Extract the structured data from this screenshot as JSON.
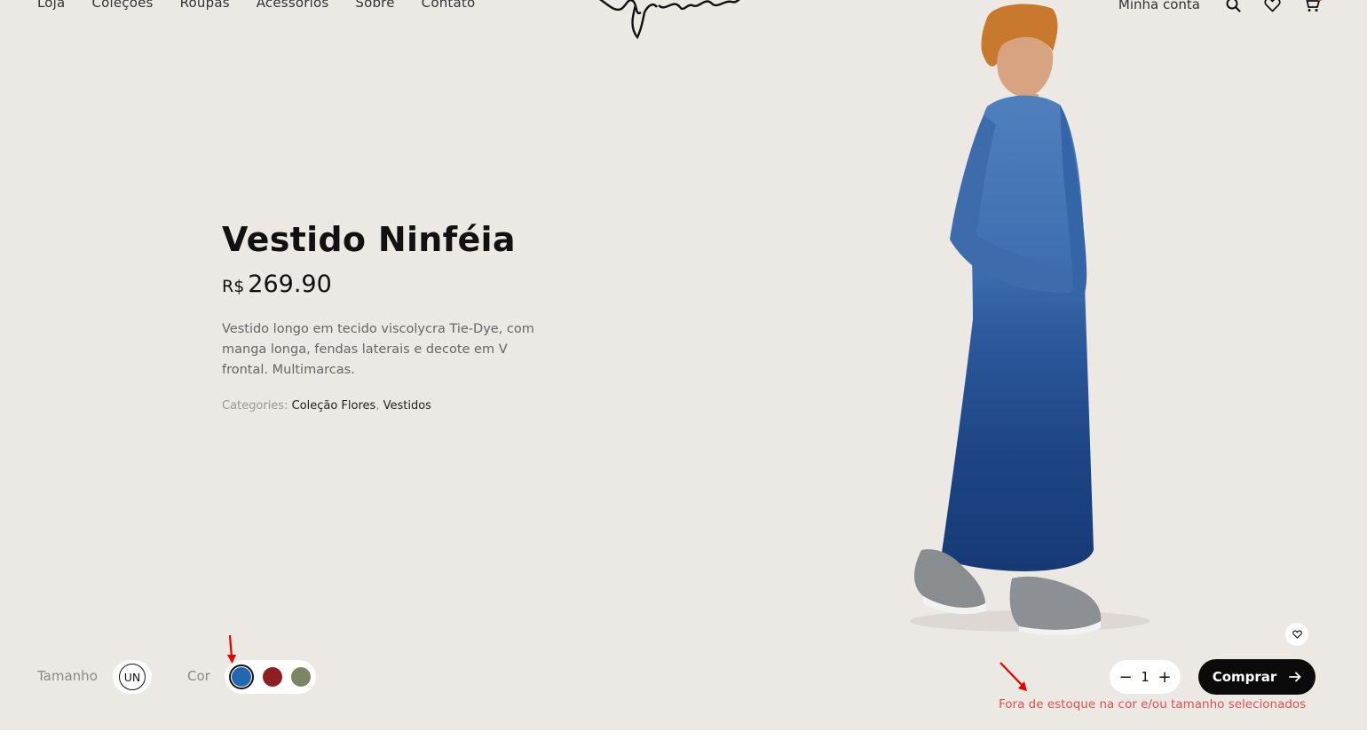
{
  "nav": {
    "left_items": [
      "Loja",
      "Coleções",
      "Roupas",
      "Acessórios",
      "Sobre",
      "Contato"
    ],
    "account_label": "Minha conta",
    "icons": [
      "search-icon",
      "heart-icon",
      "cart-icon"
    ]
  },
  "product": {
    "title": "Vestido Ninféia",
    "currency": "R$",
    "price": "269.90",
    "description": "Vestido longo em tecido viscolycra Tie-Dye, com manga longa, fendas laterais e decote em V frontal. Multimarcas.",
    "categories_label": "Categories:",
    "categories": [
      "Coleção Flores",
      "Vestidos"
    ],
    "categories_sep": ","
  },
  "variations": {
    "size_label": "Tamanho",
    "sizes": [
      "UN"
    ],
    "color_label": "Cor",
    "colors": [
      {
        "name": "blue",
        "hex": "#2366b1",
        "selected": true
      },
      {
        "name": "red",
        "hex": "#8f1d24",
        "selected": false
      },
      {
        "name": "olive",
        "hex": "#7c8664",
        "selected": false
      }
    ]
  },
  "cart": {
    "quantity": "1",
    "minus": "−",
    "plus": "+",
    "buy_label": "Comprar",
    "stock_message": "Fora de estoque na cor e/ou tamanho selecionados"
  },
  "colors": {
    "background": "#ece8e4",
    "annotation": "#e60000",
    "error": "#e05050"
  }
}
